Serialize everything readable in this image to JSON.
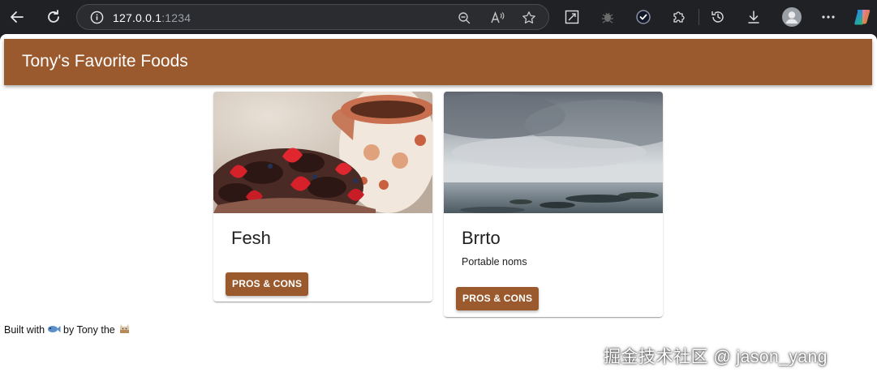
{
  "browser": {
    "url_host": "127.0.0.1",
    "url_port": ":1234",
    "icons": {
      "back": "back-arrow-icon",
      "refresh": "refresh-icon",
      "info": "info-icon",
      "zoom": "zoom-out-icon",
      "read_aloud": "read-aloud-icon",
      "favorite": "star-icon",
      "collections": "screenshot-icon",
      "extension_bug": "bug-icon",
      "check_extension": "check-shield-icon",
      "extensions": "puzzle-icon",
      "history": "history-icon",
      "downloads": "download-icon",
      "profile": "profile-icon",
      "more": "more-icon",
      "copilot": "copilot-icon"
    }
  },
  "app": {
    "title": "Tony's Favorite Foods",
    "accent": "#9a5a2e"
  },
  "cards": [
    {
      "name": "Fesh",
      "description": "",
      "button": "PROS & CONS",
      "image": "chocolate-strawberry-dessert-photo"
    },
    {
      "name": "Brrto",
      "description": "Portable noms",
      "button": "PROS & CONS",
      "image": "cloudy-seascape-photo"
    }
  ],
  "footer": {
    "prefix": "Built with",
    "middle": "by Tony the",
    "icon1": "fish-icon",
    "icon2": "cat-icon"
  },
  "watermark": "掘金技术社区 @ jason_yang"
}
